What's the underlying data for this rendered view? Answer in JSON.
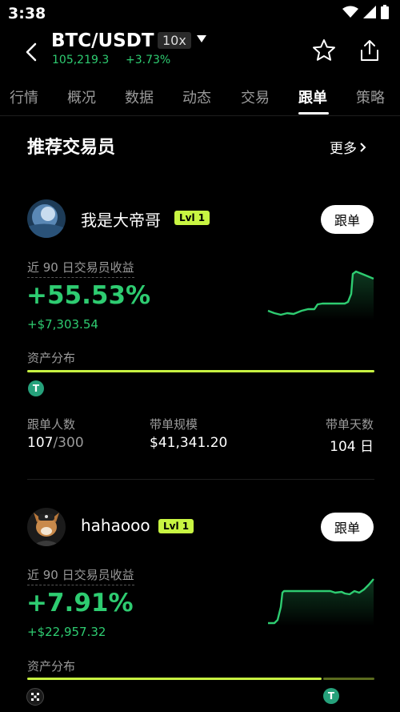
{
  "status_bar": {
    "time": "3:38"
  },
  "header": {
    "pair": "BTC/USDT",
    "leverage": "10x",
    "price": "105,219.3",
    "change": "+3.73%"
  },
  "tabs": [
    {
      "label": "行情"
    },
    {
      "label": "概况"
    },
    {
      "label": "数据"
    },
    {
      "label": "动态"
    },
    {
      "label": "交易"
    },
    {
      "label": "跟单",
      "active": true
    },
    {
      "label": "策略"
    }
  ],
  "section": {
    "title": "推荐交易员",
    "more_label": "更多"
  },
  "traders": [
    {
      "name": "我是大帝哥",
      "level": "Lvl 1",
      "follow_label": "跟单",
      "pnl_label": "近 90 日交易员收益",
      "pnl_pct": "+55.53%",
      "pnl_amount": "+$7,303.54",
      "assets_label": "资产分布",
      "stats": {
        "followers_label": "跟单人数",
        "followers_current": "107",
        "followers_max": "/300",
        "aum_label": "带单规模",
        "aum_value": "$41,341.20",
        "days_label": "带单天数",
        "days_value": "104 日"
      }
    },
    {
      "name": "hahaooo",
      "level": "Lvl 1",
      "follow_label": "跟单",
      "pnl_label": "近 90 日交易员收益",
      "pnl_pct": "+7.91%",
      "pnl_amount": "+$22,957.32",
      "assets_label": "资产分布"
    }
  ],
  "colors": {
    "up": "#2ecc71",
    "accent": "#c8f542",
    "background": "#000000"
  },
  "icons": [
    "back-arrow-icon",
    "dropdown-caret-icon",
    "star-icon",
    "share-icon",
    "chevron-right-icon",
    "tether-coin-icon",
    "dice-coin-icon"
  ]
}
